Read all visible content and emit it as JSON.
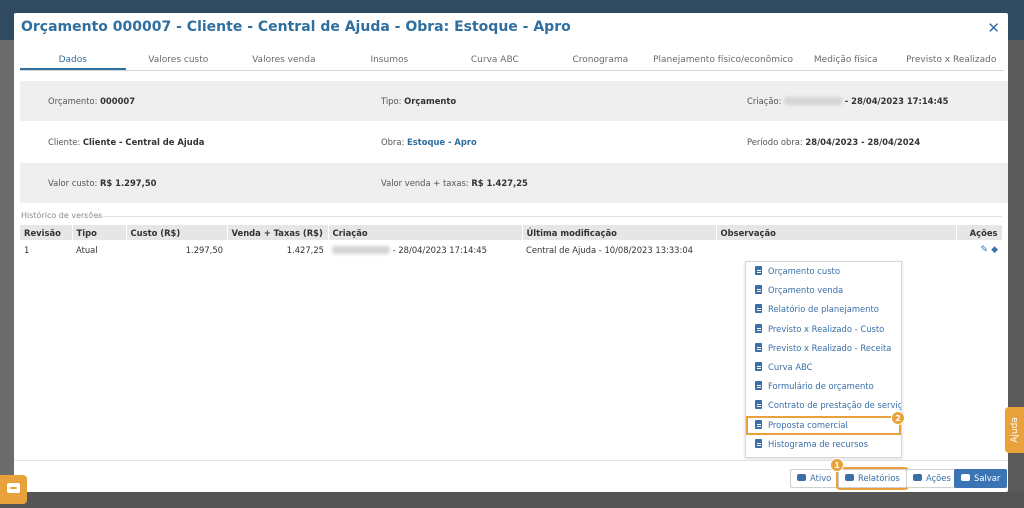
{
  "modal": {
    "title": "Orçamento 000007 - Cliente - Central de Ajuda - Obra: Estoque - Apro",
    "close_glyph": "✕"
  },
  "tabs": [
    {
      "label": "Dados",
      "active": true
    },
    {
      "label": "Valores custo"
    },
    {
      "label": "Valores venda"
    },
    {
      "label": "Insumos"
    },
    {
      "label": "Curva ABC"
    },
    {
      "label": "Cronograma"
    },
    {
      "label": "Planejamento físico/econômico"
    },
    {
      "label": "Medição física"
    },
    {
      "label": "Previsto x Realizado"
    }
  ],
  "info": {
    "orcamento_label": "Orçamento:",
    "orcamento_value": "000007",
    "tipo_label": "Tipo:",
    "tipo_value": "Orçamento",
    "criacao_label": "Criação:",
    "criacao_value": "- 28/04/2023 17:14:45",
    "cliente_label": "Cliente:",
    "cliente_value": "Cliente - Central de Ajuda",
    "obra_label": "Obra:",
    "obra_value": "Estoque - Apro",
    "periodo_label": "Período obra:",
    "periodo_value": "28/04/2023 - 28/04/2024",
    "valor_custo_label": "Valor custo:",
    "valor_custo_value": "R$ 1.297,50",
    "valor_venda_label": "Valor venda + taxas:",
    "valor_venda_value": "R$ 1.427,25"
  },
  "history": {
    "label": "Histórico de versões",
    "columns": [
      "Revisão",
      "Tipo",
      "Custo (R$)",
      "Venda + Taxas (R$)",
      "Criação",
      "Última modificação",
      "Observação",
      "Ações"
    ],
    "rows": [
      {
        "revisao": "1",
        "tipo": "Atual",
        "custo": "1.297,50",
        "venda": "1.427,25",
        "criacao": "- 28/04/2023 17:14:45",
        "ultima": "Central de Ajuda - 10/08/2023 13:33:04",
        "observacao": ""
      }
    ]
  },
  "reports_menu": [
    "Orçamento custo",
    "Orçamento venda",
    "Relatório de planejamento",
    "Previsto x Realizado - Custo",
    "Previsto x Realizado - Receita",
    "Curva ABC",
    "Formulário de orçamento",
    "Contrato de prestação de serviço",
    "Proposta comercial",
    "Histograma de recursos"
  ],
  "footer": {
    "ativo": "Ativo",
    "relatorios": "Relatórios",
    "acoes": "Ações",
    "salvar": "Salvar"
  },
  "badges": {
    "step1": "1",
    "step2": "2"
  },
  "ajuda": "Ajuda",
  "icons": {
    "doc": "document-icon",
    "edit": "pencil-icon",
    "tag": "tag-icon",
    "chat": "chat-icon"
  },
  "colors": {
    "primary": "#2f6f9f",
    "accent": "#e9a23b",
    "save": "#3b74b4"
  }
}
